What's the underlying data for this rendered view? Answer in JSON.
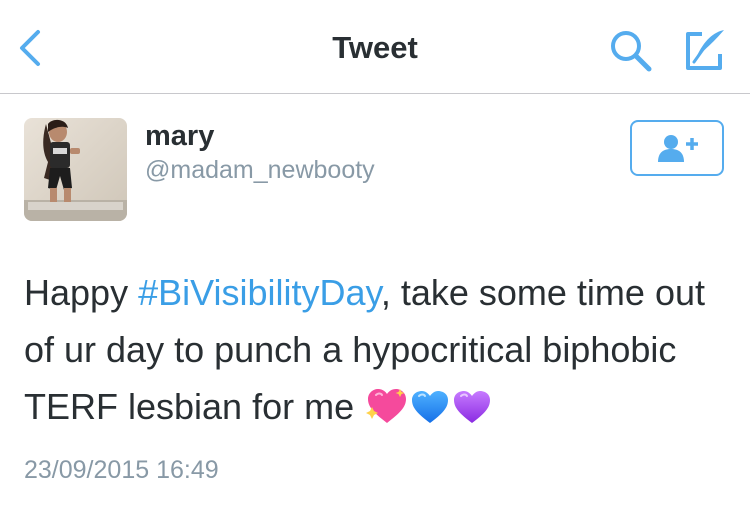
{
  "navbar": {
    "title": "Tweet",
    "icons": {
      "back": "chevron-left-icon",
      "search": "search-icon",
      "compose": "compose-tweet-icon"
    }
  },
  "tweet": {
    "author": {
      "name": "mary",
      "handle": "@madam_newbooty",
      "avatar": "avatar-photo"
    },
    "follow_icon": "add-user-icon",
    "text_before": "Happy ",
    "hashtag": "#BiVisibilityDay",
    "text_after": ", take some time out of ur day to punch a hypocritical biphobic TERF lesbian for me ",
    "emojis": [
      "sparkling-heart-emoji",
      "blue-heart-emoji",
      "purple-heart-emoji"
    ],
    "timestamp": "23/09/2015 16:49"
  },
  "colors": {
    "accent": "#55acee",
    "hashtag": "#3a9ee6",
    "text": "#292f33",
    "secondary": "#8899a6",
    "divider": "#c8c8cc"
  }
}
